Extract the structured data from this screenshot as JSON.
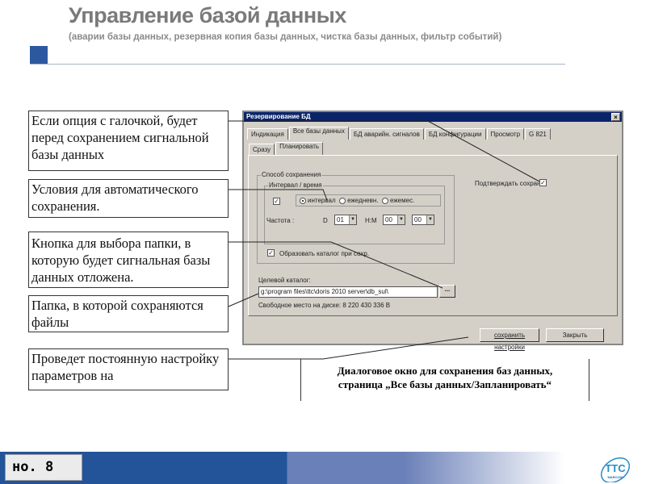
{
  "header": {
    "title": "Управление базой данных",
    "subtitle": "(аварии базы данных, резервная копия базы данных, чистка базы данных, фильтр событий)"
  },
  "callouts": [
    "Если опция с галочкой, будет перед сохранением сигнальной базы данных",
    "Условия для автоматического сохранения.",
    "Кнопка для выбора папки, в которую будет сигнальная базы данных отложена.",
    "Папка, в которой сохраняются файлы",
    "Проведет постоянную настройку параметров на"
  ],
  "dialog": {
    "title": "Резервирование БД",
    "close": "×",
    "tabs": [
      "Индикация",
      "Все базы данных",
      "БД аварийн. сигналов",
      "БД конфигурации",
      "Просмотр",
      "G 821"
    ],
    "subtabs": [
      "Сразу",
      "Планировать"
    ],
    "group_method": "Способ сохранения",
    "group_interval": "Интервал / время",
    "radio": [
      "интервал",
      "ежедневн.",
      "ежемес."
    ],
    "freq_label": "Частота :",
    "d_label": "D",
    "d_value": "01",
    "hm_label": "H:M",
    "h_value": "00",
    "m_value": "00",
    "create_dir": "Образовать каталог при сохр.",
    "confirm": "Подтверждать сохран.",
    "target_label": "Целевой каталог:",
    "target_value": "g:\\program files\\ttc\\doris 2010 server\\db_sul\\",
    "browse": "...",
    "free_space": "Свободное место на диске: 8 220 430 336 B",
    "save_settings": "сохранить настройки",
    "close_btn": "Закрыть"
  },
  "caption": {
    "line1": "Диалоговое окно для сохранения баз данных,",
    "line2": "страница „Все базы данных/Запланировать“"
  },
  "footer": {
    "page": "но. 8",
    "logo": "TTC MARCONI"
  }
}
